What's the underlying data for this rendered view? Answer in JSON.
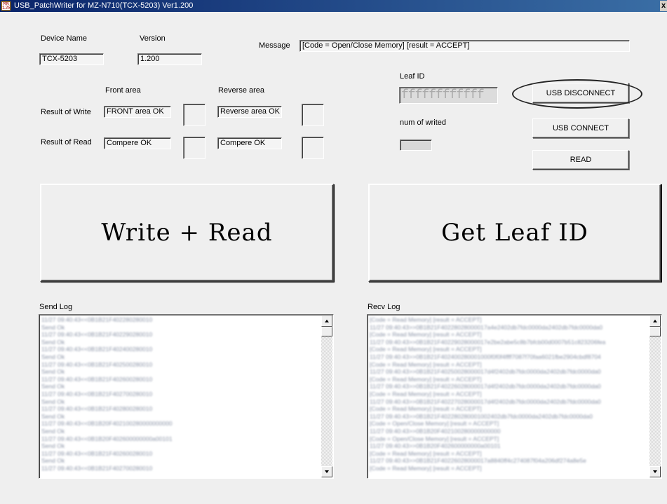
{
  "window": {
    "title": "USB_PatchWriter for MZ-N710(TCX-5203) Ver1.200",
    "icon_text": "MN 120",
    "close_label": "x"
  },
  "device": {
    "name_label": "Device Name",
    "name_value": "TCX-5203",
    "version_label": "Version",
    "version_value": "1.200"
  },
  "message": {
    "label": "Message",
    "value": "[Code = Open/Close Memory]  [result = ACCEPT]"
  },
  "results": {
    "front_area_label": "Front area",
    "reverse_area_label": "Reverse area",
    "write_label": "Result of Write",
    "read_label": "Result of Read",
    "write_front_value": "FRONT area OK",
    "write_reverse_value": "Reverse area OK",
    "read_front_value": "Compere OK",
    "read_reverse_value": "Compere OK"
  },
  "leaf": {
    "id_label": "Leaf ID",
    "id_value": "ffffffffffff",
    "num_writed_label": "num of writed"
  },
  "buttons": {
    "usb_disconnect": "USB DISCONNECT",
    "usb_connect": "USB CONNECT",
    "read": "READ",
    "write_read": "Write + Read",
    "get_leaf_id": "Get Leaf ID"
  },
  "send_log": {
    "label": "Send Log",
    "lines": [
      "11/27 09:40:43<<0B1B21F402280280010",
      "Send Ok",
      "11/27 09:40:43<<0B1B21F402290280010",
      "Send Ok",
      "11/27 09:40:43<<0B1B21F402400280010",
      "Send Ok",
      "11/27 09:40:43<<0B1B21F402500280010",
      "Send Ok",
      "11/27 09:40:43<<0B1B21F402600280010",
      "Send Ok",
      "11/27 09:40:43<<0B1B21F402700280010",
      "Send Ok",
      "11/27 09:40:43<<0B1B21F402800280010",
      "Send Ok",
      "11/27 09:40:43<<0B1B20F402100280000000000",
      "Send Ok",
      "11/27 09:40:43<<0B1B20F402600000000a00101",
      "Send Ok",
      "11/27 09:40:43<<0B1B21F402600280010",
      "Send Ok",
      "11/27 09:40:43<<0B1B21F402700280010"
    ]
  },
  "recv_log": {
    "label": "Recv Log",
    "lines": [
      "[Code = Read Memory]  [result = ACCEPT]",
      "11/27 09:40:43>>0B1B21F40228028000017a4e2402db7fdc0000da2402db7fdc0000da0",
      "[Code = Read Memory]  [result = ACCEPT]",
      "11/27 09:40:43>>0B1B21F40229028000017e2be2abe5c8b7bfcb00d0007b51c823206fea",
      "[Code = Read Memory]  [result = ACCEPT]",
      "11/27 09:40:43>>0B1B21F402400280001000f0f0f4ffff7087f70faa6021fbe2904cbdf8704",
      "[Code = Read Memory]  [result = ACCEPT]",
      "11/27 09:40:43>>0B1B21F40250028000017d4f2402db7fdc0000da2402db7fdc0000da0",
      "[Code = Read Memory]  [result = ACCEPT]",
      "11/27 09:40:43>>0B1B21F40226028000017d4f2402db7fdc0000da2402db7fdc0000da0",
      "[Code = Read Memory]  [result = ACCEPT]",
      "11/27 09:40:43>>0B1B21F40227028000017d4f2402db7fdc0000da2402db7fdc0000da0",
      "[Code = Read Memory]  [result = ACCEPT]",
      "11/27 09:40:43>>0B1B21F402280280001002402db7fdc0000da2402db7fdc0000da0",
      "[Code = Open/Close Memory]  [result = ACCEPT]",
      "11/27 09:40:43>>0B1B20F402100280000000000",
      "[Code = Open/Close Memory]  [result = ACCEPT]",
      "11/27 09:40:43>>0B1B20F402600000000a00101",
      "[Code = Read Memory]  [result = ACCEPT]",
      "11/27 09:40:43>>0B1B21F40226028000017a8840ff4c274087f04a206df274a8e5e",
      "[Code = Read Memory]  [result = ACCEPT]"
    ]
  }
}
